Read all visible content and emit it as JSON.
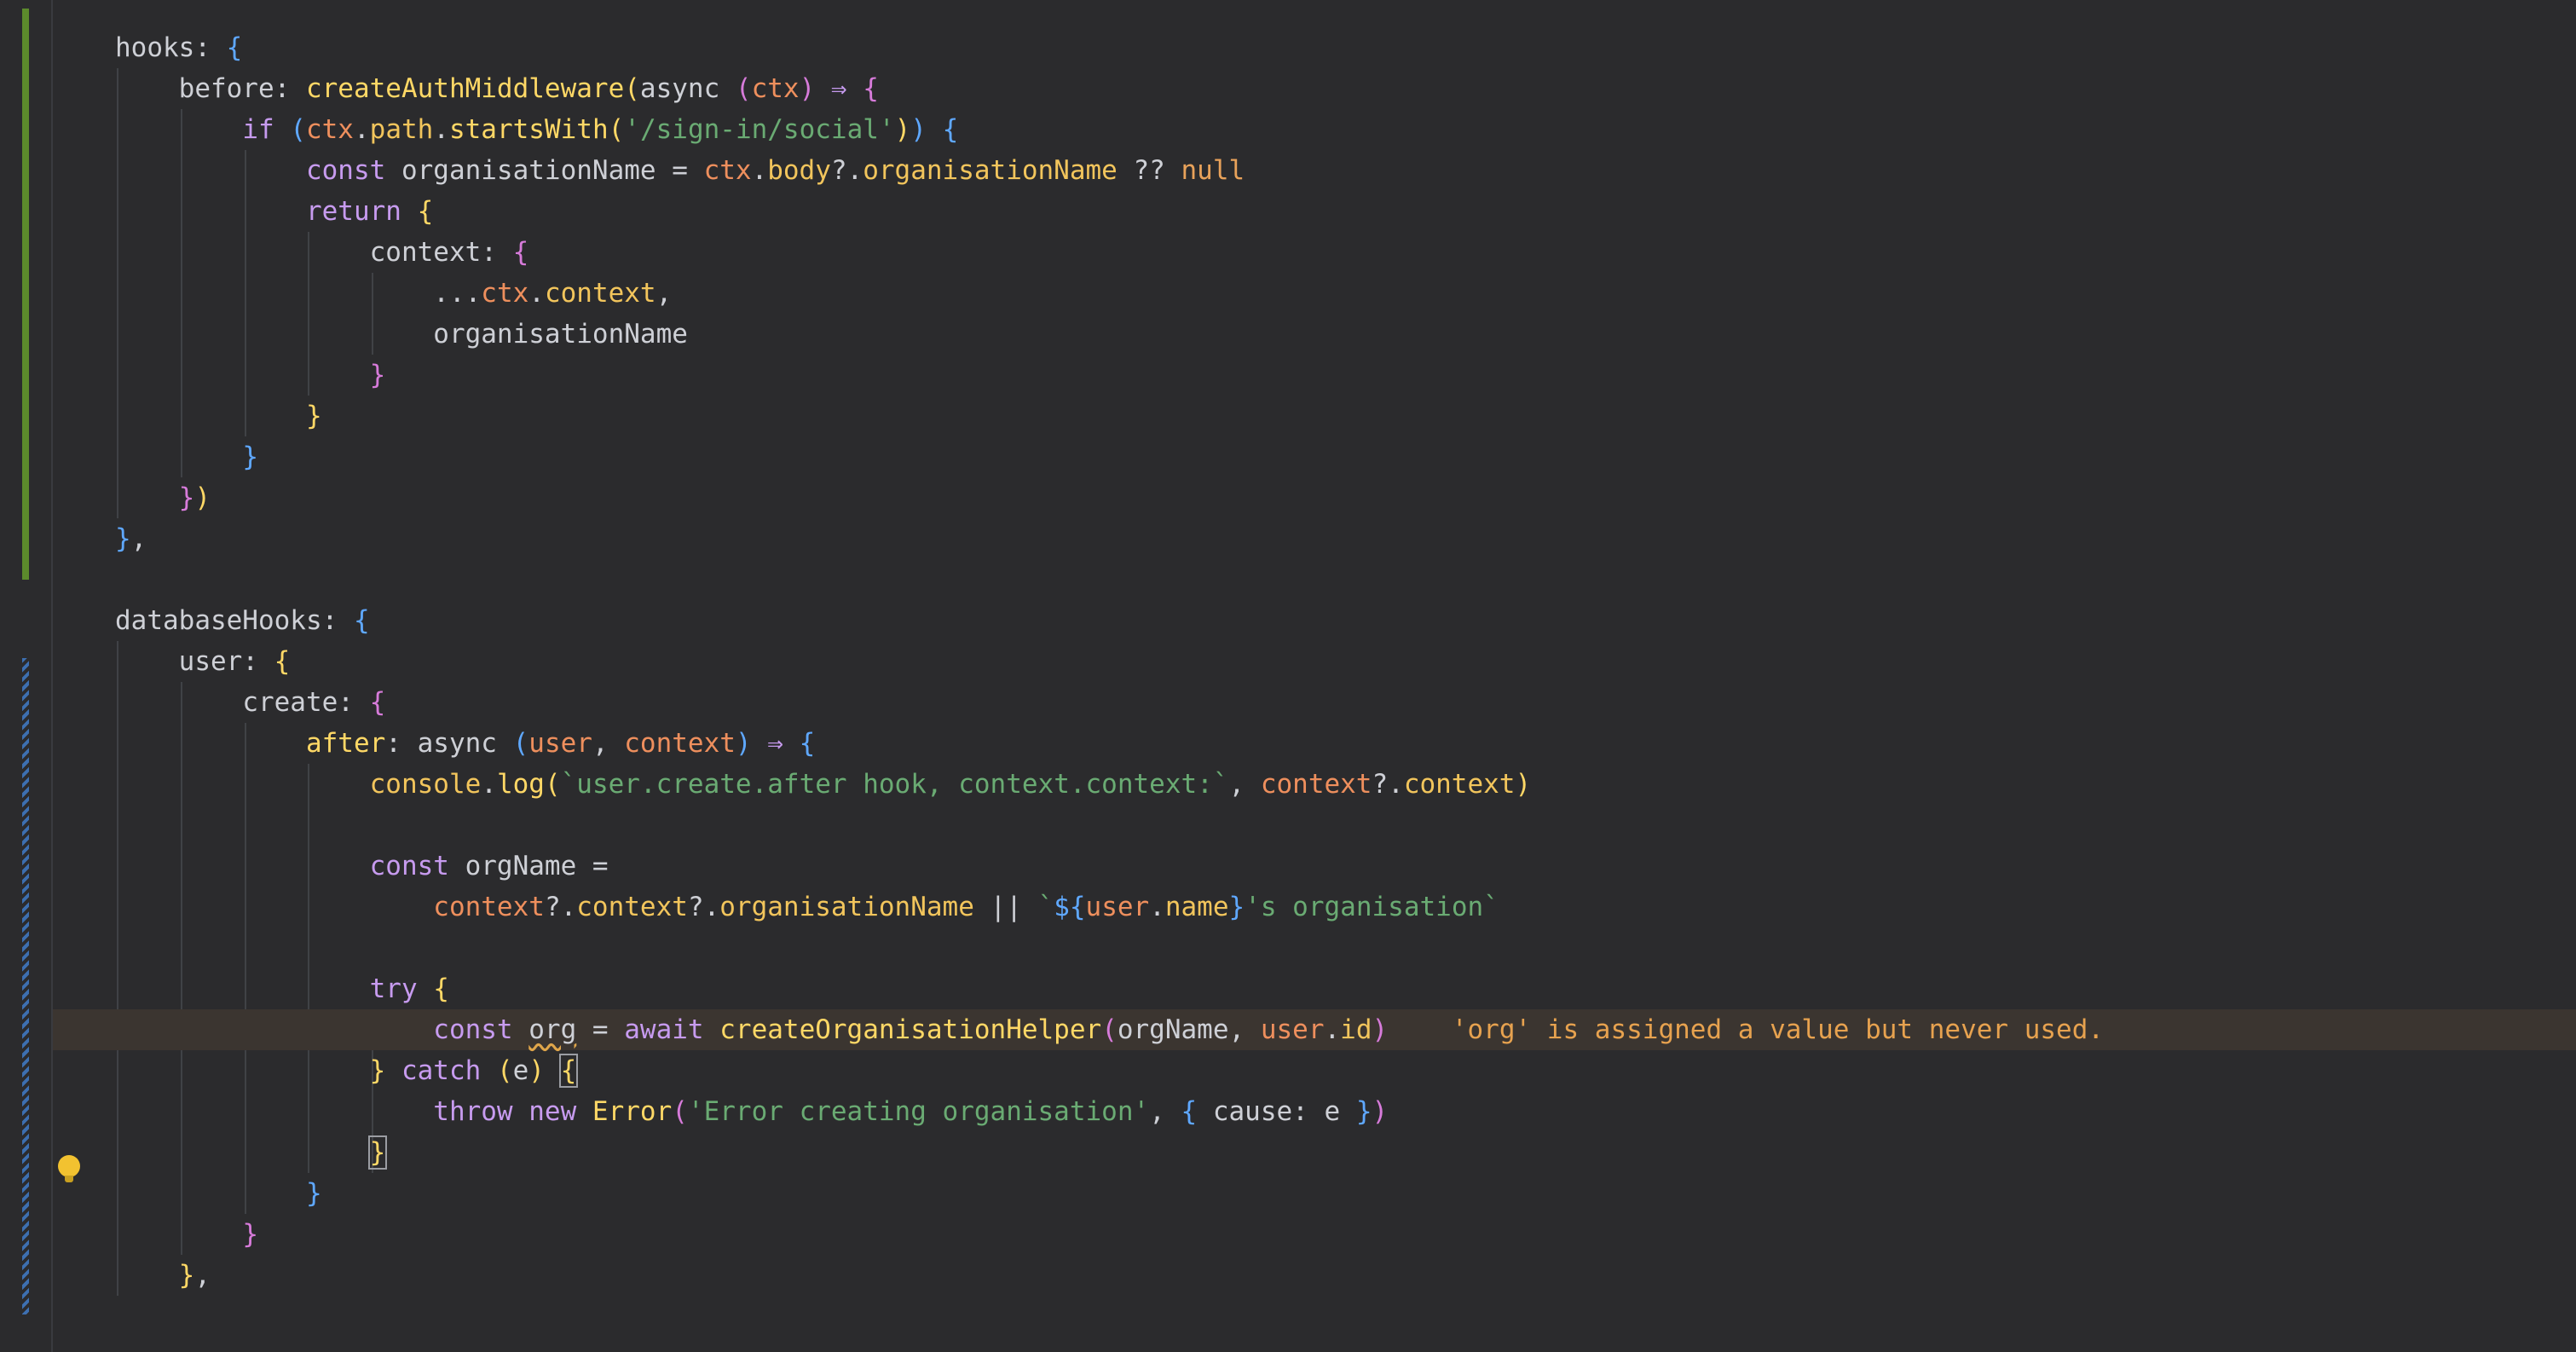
{
  "editor": {
    "lines": [
      [
        {
          "t": "hooks",
          "c": "prop"
        },
        {
          "t": ": ",
          "c": "prop"
        },
        {
          "t": "{",
          "c": "b1"
        }
      ],
      [
        {
          "t": "before",
          "c": "prop"
        },
        {
          "t": ": ",
          "c": "prop"
        },
        {
          "t": "createAuthMiddleware",
          "c": "fn"
        },
        {
          "t": "(",
          "c": "b2"
        },
        {
          "t": "async ",
          "c": "prop"
        },
        {
          "t": "(",
          "c": "b3"
        },
        {
          "t": "ctx",
          "c": "par"
        },
        {
          "t": ")",
          "c": "b3"
        },
        {
          "t": " ⇒ ",
          "c": "kw"
        },
        {
          "t": "{",
          "c": "b3"
        }
      ],
      [
        {
          "t": "if ",
          "c": "kw"
        },
        {
          "t": "(",
          "c": "b1"
        },
        {
          "t": "ctx",
          "c": "par"
        },
        {
          "t": ".",
          "c": "prop"
        },
        {
          "t": "path",
          "c": "fn2"
        },
        {
          "t": ".",
          "c": "prop"
        },
        {
          "t": "startsWith",
          "c": "fn"
        },
        {
          "t": "(",
          "c": "b2"
        },
        {
          "t": "'/sign-in/social'",
          "c": "str"
        },
        {
          "t": ")",
          "c": "b2"
        },
        {
          "t": ")",
          "c": "b1"
        },
        {
          "t": " ",
          "c": "prop"
        },
        {
          "t": "{",
          "c": "b1"
        }
      ],
      [
        {
          "t": "const ",
          "c": "kw"
        },
        {
          "t": "organisationName = ",
          "c": "prop"
        },
        {
          "t": "ctx",
          "c": "par"
        },
        {
          "t": ".",
          "c": "prop"
        },
        {
          "t": "body",
          "c": "fn2"
        },
        {
          "t": "?.",
          "c": "prop"
        },
        {
          "t": "organisationName",
          "c": "fn2"
        },
        {
          "t": " ?? ",
          "c": "prop"
        },
        {
          "t": "null",
          "c": "num"
        }
      ],
      [
        {
          "t": "return ",
          "c": "kw"
        },
        {
          "t": "{",
          "c": "b2"
        }
      ],
      [
        {
          "t": "context",
          "c": "prop"
        },
        {
          "t": ": ",
          "c": "prop"
        },
        {
          "t": "{",
          "c": "b3"
        }
      ],
      [
        {
          "t": "...",
          "c": "prop"
        },
        {
          "t": "ctx",
          "c": "par"
        },
        {
          "t": ".",
          "c": "prop"
        },
        {
          "t": "context",
          "c": "fn2"
        },
        {
          "t": ",",
          "c": "prop"
        }
      ],
      [
        {
          "t": "organisationName",
          "c": "prop"
        }
      ],
      [
        {
          "t": "}",
          "c": "b3"
        }
      ],
      [
        {
          "t": "}",
          "c": "b2"
        }
      ],
      [
        {
          "t": "}",
          "c": "b1"
        }
      ],
      [
        {
          "t": "}",
          "c": "b3"
        },
        {
          "t": ")",
          "c": "b2"
        }
      ],
      [
        {
          "t": "}",
          "c": "b1"
        },
        {
          "t": ",",
          "c": "prop"
        }
      ],
      [],
      [
        {
          "t": "databaseHooks",
          "c": "prop"
        },
        {
          "t": ": ",
          "c": "prop"
        },
        {
          "t": "{",
          "c": "b1"
        }
      ],
      [
        {
          "t": "user",
          "c": "prop"
        },
        {
          "t": ": ",
          "c": "prop"
        },
        {
          "t": "{",
          "c": "b2"
        }
      ],
      [
        {
          "t": "create",
          "c": "prop"
        },
        {
          "t": ": ",
          "c": "prop"
        },
        {
          "t": "{",
          "c": "b3"
        }
      ],
      [
        {
          "t": "after",
          "c": "fn"
        },
        {
          "t": ": ",
          "c": "prop"
        },
        {
          "t": "async ",
          "c": "prop"
        },
        {
          "t": "(",
          "c": "b1"
        },
        {
          "t": "user",
          "c": "par"
        },
        {
          "t": ", ",
          "c": "prop"
        },
        {
          "t": "context",
          "c": "par"
        },
        {
          "t": ")",
          "c": "b1"
        },
        {
          "t": " ⇒ ",
          "c": "kw"
        },
        {
          "t": "{",
          "c": "b1"
        }
      ],
      [
        {
          "t": "console",
          "c": "fn2"
        },
        {
          "t": ".",
          "c": "prop"
        },
        {
          "t": "log",
          "c": "fn"
        },
        {
          "t": "(",
          "c": "b2"
        },
        {
          "t": "`user.create.after hook, context.context:`",
          "c": "str"
        },
        {
          "t": ", ",
          "c": "prop"
        },
        {
          "t": "context",
          "c": "par"
        },
        {
          "t": "?.",
          "c": "prop"
        },
        {
          "t": "context",
          "c": "fn2"
        },
        {
          "t": ")",
          "c": "b2"
        }
      ],
      [],
      [
        {
          "t": "const ",
          "c": "kw"
        },
        {
          "t": "orgName =",
          "c": "prop"
        }
      ],
      [
        {
          "t": "context",
          "c": "par"
        },
        {
          "t": "?.",
          "c": "prop"
        },
        {
          "t": "context",
          "c": "fn2"
        },
        {
          "t": "?.",
          "c": "prop"
        },
        {
          "t": "organisationName",
          "c": "fn2"
        },
        {
          "t": " || ",
          "c": "prop"
        },
        {
          "t": "`",
          "c": "str"
        },
        {
          "t": "${",
          "c": "b1"
        },
        {
          "t": "user",
          "c": "par"
        },
        {
          "t": ".",
          "c": "prop"
        },
        {
          "t": "name",
          "c": "fn2"
        },
        {
          "t": "}",
          "c": "b1"
        },
        {
          "t": "'s organisation`",
          "c": "str"
        }
      ],
      [],
      [
        {
          "t": "try ",
          "c": "kw"
        },
        {
          "t": "{",
          "c": "b2"
        }
      ],
      [
        {
          "t": "const ",
          "c": "kw"
        },
        {
          "t": "org",
          "c": "prop",
          "sq": true
        },
        {
          "t": " = ",
          "c": "prop"
        },
        {
          "t": "await ",
          "c": "kw"
        },
        {
          "t": "createOrganisationHelper",
          "c": "fn"
        },
        {
          "t": "(",
          "c": "b3"
        },
        {
          "t": "orgName, ",
          "c": "prop"
        },
        {
          "t": "user",
          "c": "par"
        },
        {
          "t": ".",
          "c": "prop"
        },
        {
          "t": "id",
          "c": "fn2"
        },
        {
          "t": ")",
          "c": "b3"
        }
      ],
      [
        {
          "t": "} ",
          "c": "b2"
        },
        {
          "t": "catch ",
          "c": "kw"
        },
        {
          "t": "(",
          "c": "b2"
        },
        {
          "t": "e",
          "c": "prop"
        },
        {
          "t": ")",
          "c": "b2"
        },
        {
          "t": " ",
          "c": "prop"
        },
        {
          "t": "{",
          "c": "b2",
          "box": true
        }
      ],
      [
        {
          "t": "throw ",
          "c": "kw"
        },
        {
          "t": "new ",
          "c": "kw"
        },
        {
          "t": "Error",
          "c": "fn"
        },
        {
          "t": "(",
          "c": "b3"
        },
        {
          "t": "'Error creating organisation'",
          "c": "str"
        },
        {
          "t": ", ",
          "c": "prop"
        },
        {
          "t": "{",
          "c": "b1"
        },
        {
          "t": " cause: e ",
          "c": "prop"
        },
        {
          "t": "}",
          "c": "b1"
        },
        {
          "t": ")",
          "c": "b3"
        }
      ],
      [
        {
          "t": "}",
          "c": "b2",
          "box": true
        }
      ],
      [
        {
          "t": "}",
          "c": "b1"
        }
      ],
      [
        {
          "t": "}",
          "c": "b3"
        }
      ],
      [
        {
          "t": "}",
          "c": "b2"
        },
        {
          "t": ",",
          "c": "prop"
        }
      ]
    ],
    "inlay_warning": "'org' is assigned a value but never used.",
    "colors": {
      "background": "#2b2b2d",
      "current_line": "#3b3530",
      "vcs_added": "#5c8a2c",
      "vcs_modified": "#3d6fb0",
      "warning": "#e7a24f"
    },
    "icons": [
      "lightbulb-icon"
    ]
  }
}
